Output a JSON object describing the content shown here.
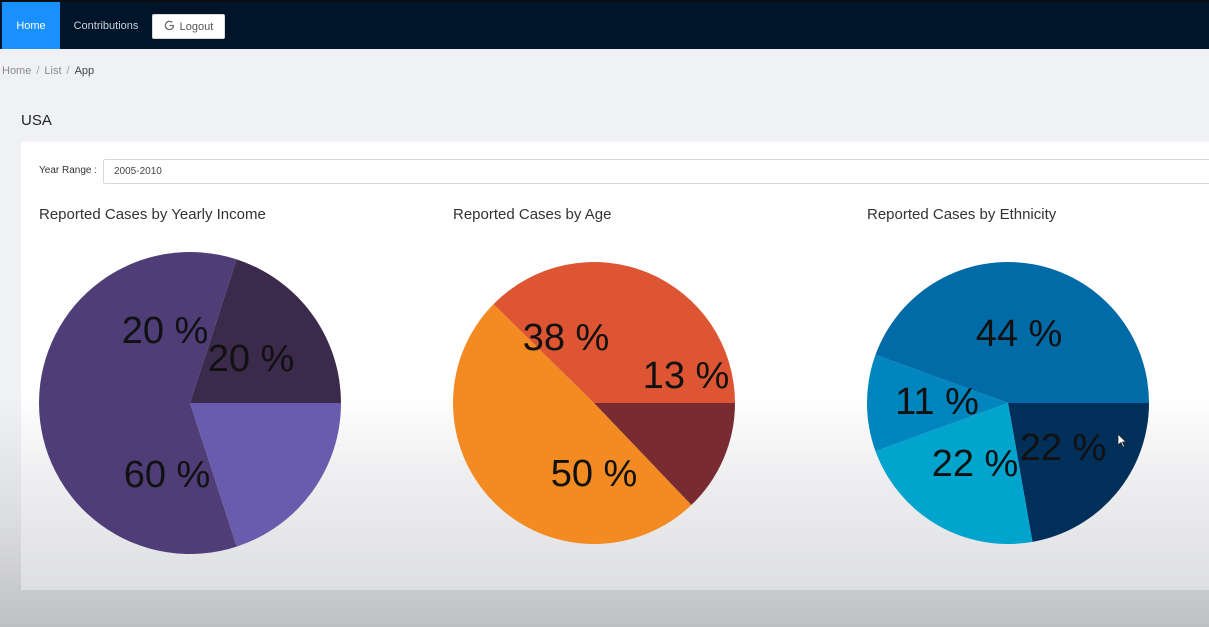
{
  "nav": {
    "home_label": "Home",
    "contributions_label": "Contributions",
    "logout_label": "Logout",
    "active_color": "#1890ff",
    "bar_color": "#001529"
  },
  "breadcrumb": {
    "items": [
      "Home",
      "List",
      "App"
    ],
    "separator": "/"
  },
  "page": {
    "title": "USA"
  },
  "filters": {
    "year_range_label": "Year Range :",
    "year_range_value": "2005-2010"
  },
  "chart_data": [
    {
      "type": "pie",
      "title": "Reported Cases by Yearly Income",
      "slices": [
        {
          "value": 20,
          "label": "20 %",
          "color": "#6a5cad"
        },
        {
          "value": 60,
          "label": "60 %",
          "color": "#4f3d78"
        },
        {
          "value": 20,
          "label": "20 %",
          "color": "#3c2a4c"
        }
      ]
    },
    {
      "type": "pie",
      "title": "Reported Cases by Age",
      "slices": [
        {
          "value": 13,
          "label": "13 %",
          "color": "#782c32"
        },
        {
          "value": 50,
          "label": "50 %",
          "color": "#f38a22"
        },
        {
          "value": 38,
          "label": "38 %",
          "color": "#dd5533"
        }
      ]
    },
    {
      "type": "pie",
      "title": "Reported Cases by Ethnicity",
      "slices": [
        {
          "value": 22,
          "label": "22 %",
          "color": "#002f5a"
        },
        {
          "value": 22,
          "label": "22 %",
          "color": "#00a4cd"
        },
        {
          "value": 11,
          "label": "11 %",
          "color": "#0085bf"
        },
        {
          "value": 44,
          "label": "44 %",
          "color": "#006ba6"
        }
      ]
    }
  ]
}
